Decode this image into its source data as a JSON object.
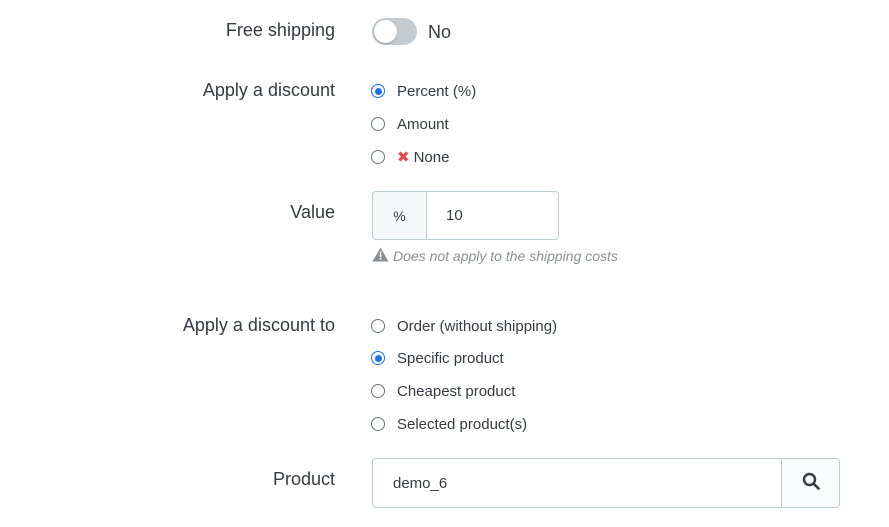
{
  "free_shipping": {
    "label": "Free shipping",
    "state_text": "No",
    "enabled": false
  },
  "apply_discount": {
    "label": "Apply a discount",
    "options": [
      {
        "label": "Percent (%)",
        "checked": true
      },
      {
        "label": "Amount",
        "checked": false
      },
      {
        "label": "None",
        "checked": false,
        "icon": "x-icon"
      }
    ]
  },
  "value": {
    "label": "Value",
    "addon": "%",
    "input_value": "10",
    "hint": "Does not apply to the shipping costs",
    "hint_icon": "warning-icon"
  },
  "apply_discount_to": {
    "label": "Apply a discount to",
    "options": [
      {
        "label": "Order (without shipping)",
        "checked": false
      },
      {
        "label": "Specific product",
        "checked": true
      },
      {
        "label": "Cheapest product",
        "checked": false
      },
      {
        "label": "Selected product(s)",
        "checked": false
      }
    ]
  },
  "product": {
    "label": "Product",
    "input_value": "demo_6",
    "search_icon": "search-icon"
  },
  "colors": {
    "accent": "#1a73e8",
    "error_icon": "#e24a4a",
    "toggle_off": "#c6cbd0"
  }
}
